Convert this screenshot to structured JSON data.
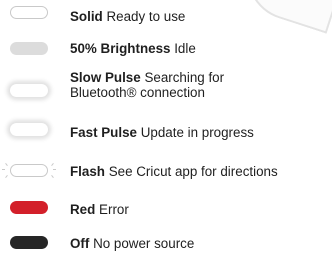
{
  "legend": {
    "items": [
      {
        "mode": "Solid",
        "desc": "Ready to use",
        "light_color": "#ffffff",
        "style": "outline"
      },
      {
        "mode": "50% Brightness",
        "desc": "Idle",
        "light_color": "#dcdcdc",
        "style": "gray"
      },
      {
        "mode": "Slow Pulse",
        "desc": "Searching for",
        "desc_line2": "Bluetooth® connection",
        "light_color": "#ffffff",
        "style": "soft"
      },
      {
        "mode": "Fast Pulse",
        "desc": "Update in progress",
        "light_color": "#ffffff",
        "style": "soft"
      },
      {
        "mode": "Flash",
        "desc": "See Cricut app for directions",
        "light_color": "#ffffff",
        "style": "flash"
      },
      {
        "mode": "Red",
        "desc": "Error",
        "light_color": "#d3202a",
        "style": "red"
      },
      {
        "mode": "Off",
        "desc": "No power source",
        "light_color": "#262626",
        "style": "off"
      }
    ]
  }
}
